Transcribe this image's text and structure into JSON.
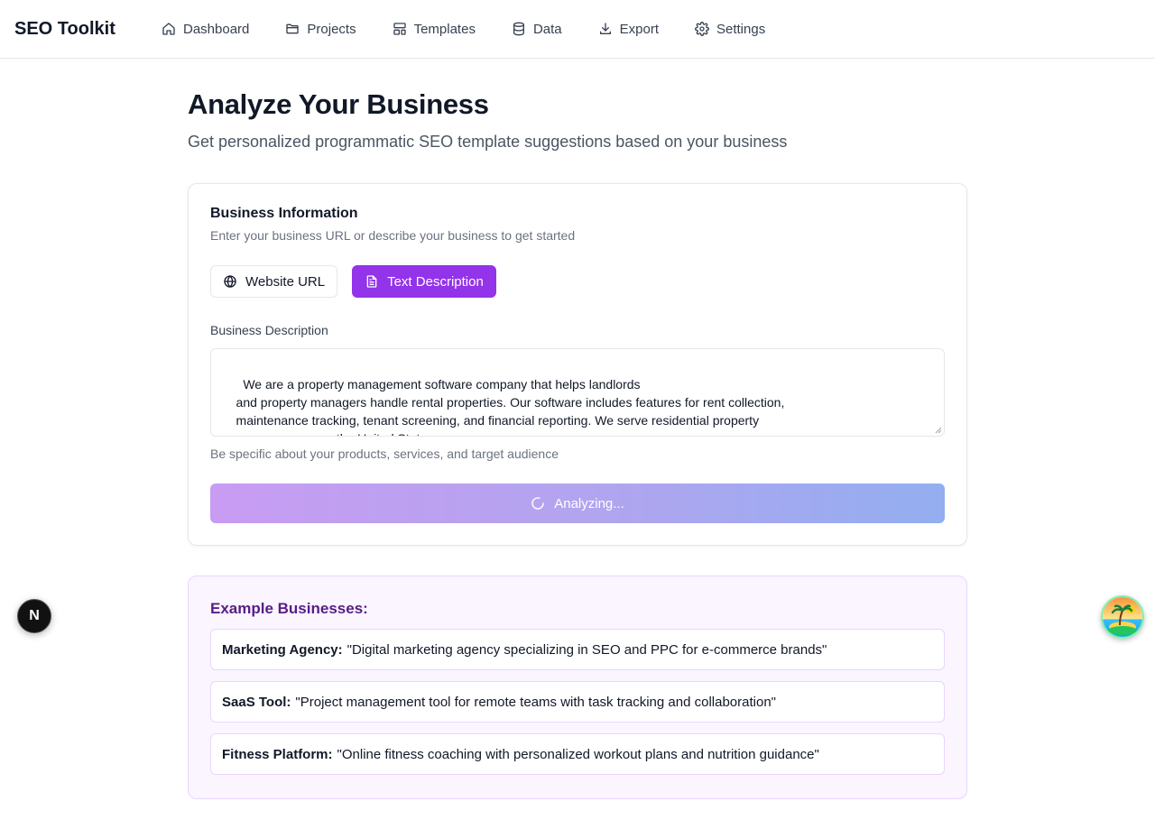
{
  "brand": "SEO Toolkit",
  "nav": [
    {
      "label": "Dashboard",
      "icon": "home-icon"
    },
    {
      "label": "Projects",
      "icon": "folder-icon"
    },
    {
      "label": "Templates",
      "icon": "layout-icon"
    },
    {
      "label": "Data",
      "icon": "database-icon"
    },
    {
      "label": "Export",
      "icon": "download-icon"
    },
    {
      "label": "Settings",
      "icon": "gear-icon"
    }
  ],
  "page": {
    "title": "Analyze Your Business",
    "subtitle": "Get personalized programmatic SEO template suggestions based on your business"
  },
  "card": {
    "title": "Business Information",
    "description": "Enter your business URL or describe your business to get started",
    "modes": {
      "url_label": "Website URL",
      "text_label": "Text Description",
      "active": "text"
    },
    "field_label": "Business Description",
    "field_value": "We are a property management software company that helps landlords\n    and property managers handle rental properties. Our software includes features for rent collection,\n    maintenance tracking, tenant screening, and financial reporting. We serve residential property\n    managers across the United States.",
    "hint": "Be specific about your products, services, and target audience",
    "analyze_label": "Analyzing..."
  },
  "examples": {
    "title": "Example Businesses:",
    "items": [
      {
        "name": "Marketing Agency:",
        "text": "\"Digital marketing agency specializing in SEO and PPC for e-commerce brands\""
      },
      {
        "name": "SaaS Tool:",
        "text": "\"Project management tool for remote teams with task tracking and collaboration\""
      },
      {
        "name": "Fitness Platform:",
        "text": "\"Online fitness coaching with personalized workout plans and nutrition guidance\""
      }
    ]
  },
  "badge_letter": "N",
  "colors": {
    "accent": "#9333ea",
    "examples_bg": "#faf5ff",
    "examples_title": "#581c87"
  }
}
